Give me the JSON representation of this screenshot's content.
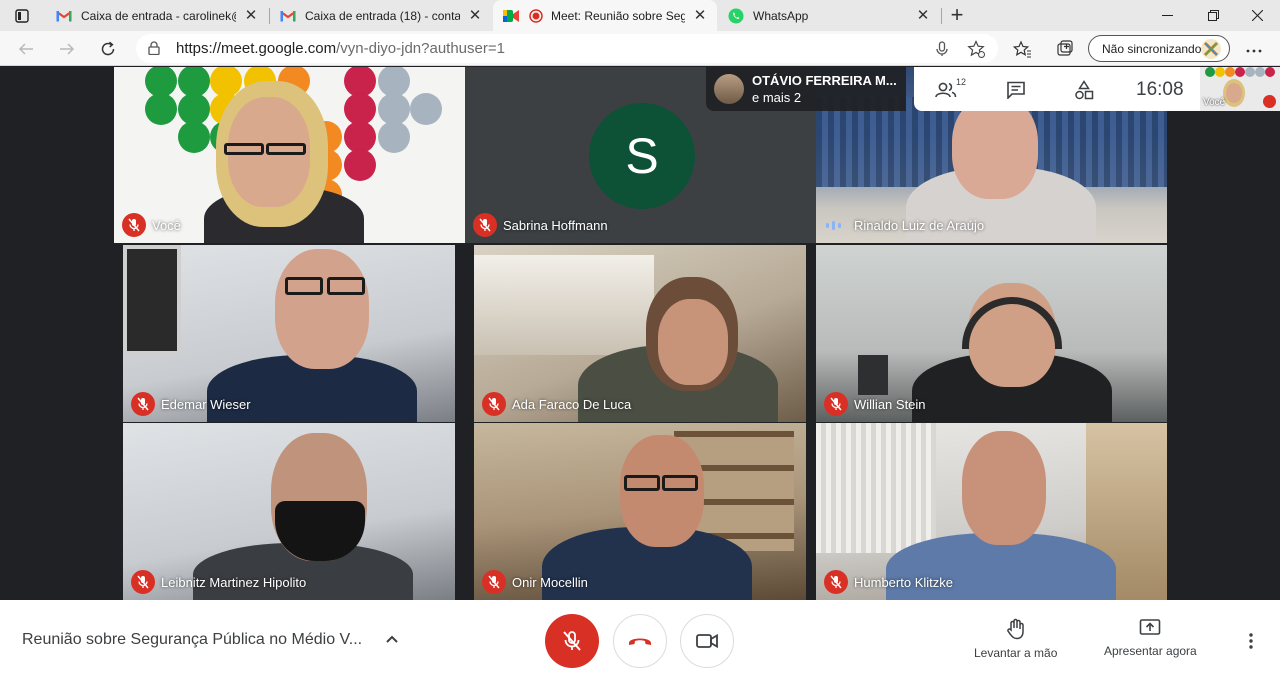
{
  "browser": {
    "tabs": [
      {
        "title": "Caixa de entrada - carolinek@fa",
        "favicon": "gmail-icon",
        "active": false
      },
      {
        "title": "Caixa de entrada (18) - contato@",
        "favicon": "gmail-icon",
        "active": false
      },
      {
        "title": "Meet: Reunião sobre Segura",
        "favicon": "meet-icon",
        "recording": true,
        "active": true
      },
      {
        "title": "WhatsApp",
        "favicon": "whatsapp-icon",
        "active": false
      }
    ],
    "url_host": "https://meet.google.com",
    "url_path": "/vyn-diyo-jdn?authuser=1",
    "sync_label": "Não sincronizando"
  },
  "meet": {
    "presenter": {
      "name": "OTÁVIO FERREIRA M...",
      "more": "e mais 2"
    },
    "participants_count": "12",
    "clock": "16:08",
    "self_label": "Você",
    "avatar_letter": "S",
    "tiles": [
      {
        "name": "Você",
        "muted": true
      },
      {
        "name": "Sabrina Hoffmann",
        "muted": true
      },
      {
        "name": "Rinaldo Luiz de Araújo",
        "muted": false,
        "speaking": true
      },
      {
        "name": "Edemar Wieser",
        "muted": true
      },
      {
        "name": "Ada Faraco De Luca",
        "muted": true
      },
      {
        "name": "Willian Stein",
        "muted": true
      },
      {
        "name": "Leibnitz Martinez Hipolito",
        "muted": true
      },
      {
        "name": "Onir Mocellin",
        "muted": true
      },
      {
        "name": "Humberto Klitzke",
        "muted": true
      }
    ]
  },
  "controls": {
    "meeting_title": "Reunião sobre Segurança Pública no Médio V...",
    "raise_hand_label": "Levantar a mão",
    "present_label": "Apresentar agora"
  },
  "colors": {
    "meet_dark": "#202124",
    "mute_red": "#d93025",
    "avatar_green": "#0d5136",
    "speaking_blue": "#8ab4f8"
  }
}
